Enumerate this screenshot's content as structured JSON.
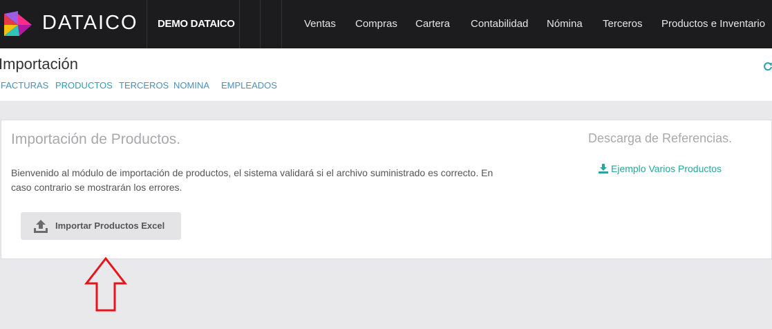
{
  "navbar": {
    "brand": "DATAICO",
    "company": "DEMO DATAICO",
    "items": [
      "Ventas",
      "Compras",
      "Cartera",
      "Contabilidad",
      "Nómina",
      "Terceros",
      "Productos e Inventario"
    ]
  },
  "header": {
    "title": "Importación",
    "tabs": [
      "FACTURAS",
      "PRODUCTOS",
      "TERCEROS",
      "NOMINA",
      "EMPLEADOS"
    ],
    "active_tab": "PRODUCTOS"
  },
  "card": {
    "title": "Importación de Productos.",
    "description": "Bienvenido al módulo de importación de productos, el sistema validará si el archivo suministrado es correcto. En caso contrario se mostrarán los errores.",
    "import_button": "Importar Productos Excel",
    "references_title": "Descarga de Referencias.",
    "references_link": "Ejemplo Varios Productos"
  },
  "colors": {
    "navbar_bg": "#1c1c1e",
    "link": "#4a90b8",
    "active_tab": "#26a2b0",
    "download_link": "#26a69a",
    "annotation_arrow": "#e8141c"
  },
  "icons": [
    "dataico-logo",
    "upload-icon",
    "download-icon",
    "refresh-icon",
    "arrow-annotation"
  ]
}
